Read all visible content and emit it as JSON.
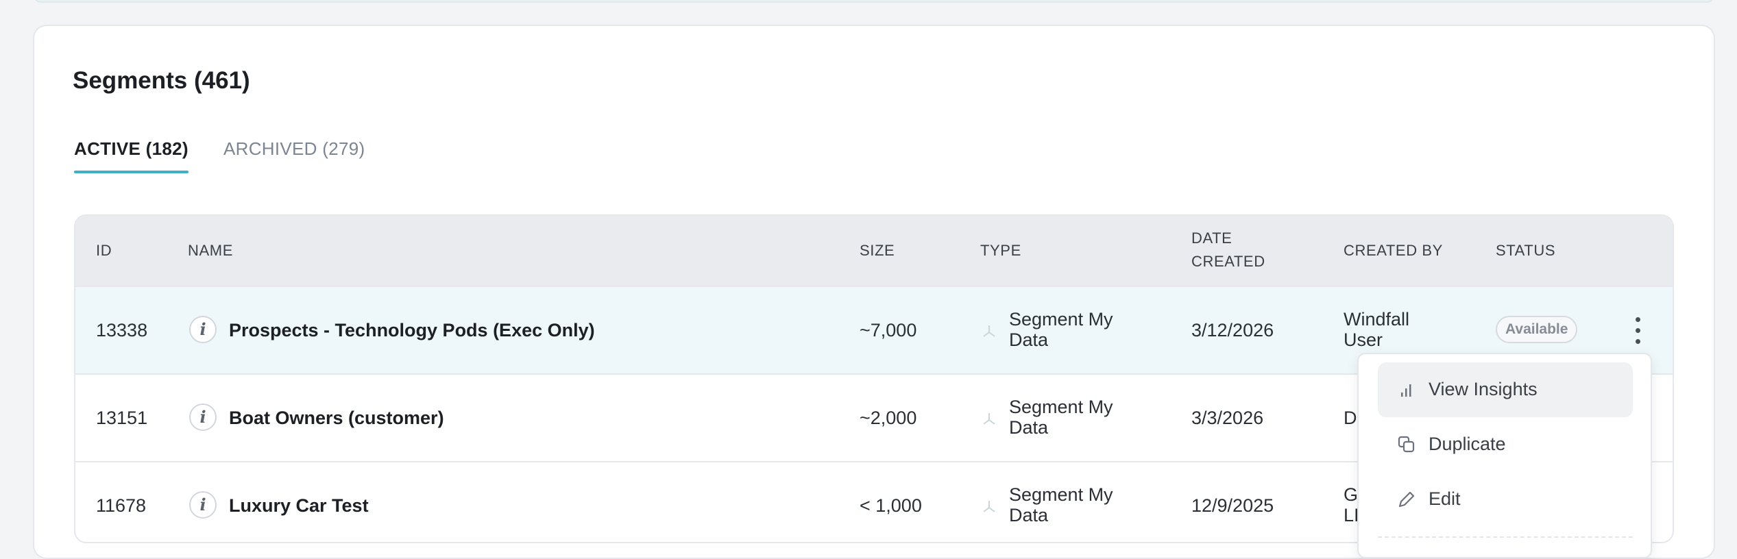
{
  "page": {
    "title": "Segments (461)",
    "tabs": [
      {
        "label": "ACTIVE (182)"
      },
      {
        "label": "ARCHIVED (279)"
      }
    ]
  },
  "table": {
    "headers": {
      "id": "ID",
      "name": "NAME",
      "size": "SIZE",
      "type": "TYPE",
      "date_line1": "DATE",
      "date_line2": "CREATED",
      "created_by": "CREATED BY",
      "status": "STATUS"
    },
    "rows": [
      {
        "id": "13338",
        "name": "Prospects - Technology Pods (Exec Only)",
        "size": "~7,000",
        "type_line1": "Segment My",
        "type_line2": "Data",
        "date": "3/12/2026",
        "created_by_line1": "Windfall",
        "created_by_line2": "User",
        "status": "Available"
      },
      {
        "id": "13151",
        "name": "Boat Owners (customer)",
        "size": "~2,000",
        "type_line1": "Segment My",
        "type_line2": "Data",
        "date": "3/3/2026",
        "created_by_line1": "D",
        "created_by_line2": ""
      },
      {
        "id": "11678",
        "name": "Luxury Car Test",
        "size": "< 1,000",
        "type_line1": "Segment My",
        "type_line2": "Data",
        "date": "12/9/2025",
        "created_by_line1": "G",
        "created_by_line2": "LI"
      }
    ]
  },
  "menu": {
    "items": [
      {
        "label": "View Insights",
        "icon": "bar-chart-icon"
      },
      {
        "label": "Duplicate",
        "icon": "copy-icon"
      },
      {
        "label": "Edit",
        "icon": "pencil-icon"
      }
    ]
  },
  "colors": {
    "accent": "#3fb0c8",
    "highlight_row": "#eef7f9",
    "header_bg": "#e9ebee"
  }
}
